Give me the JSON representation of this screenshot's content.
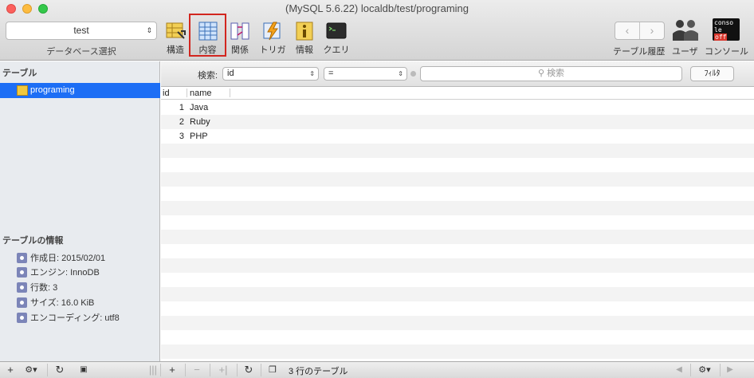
{
  "window": {
    "title": "(MySQL 5.6.22) localdb/test/programing"
  },
  "toolbar": {
    "database_selected": "test",
    "database_caption": "データベース選択",
    "buttons": [
      {
        "label": "構造",
        "icon": "structure-icon"
      },
      {
        "label": "内容",
        "icon": "content-icon",
        "active": true
      },
      {
        "label": "関係",
        "icon": "relations-icon"
      },
      {
        "label": "トリガ",
        "icon": "triggers-icon"
      },
      {
        "label": "情報",
        "icon": "info-icon"
      },
      {
        "label": "クエリ",
        "icon": "query-icon"
      }
    ],
    "history_label": "テーブル履歴",
    "user_label": "ユーザ",
    "console_label": "コンソール",
    "console_icon_text_1": "conso",
    "console_icon_text_2": "le",
    "console_icon_text_3": "off"
  },
  "sidebar": {
    "tables_heading": "テーブル",
    "tables": [
      {
        "name": "programing",
        "selected": true
      }
    ],
    "info_heading": "テーブルの情報",
    "info": [
      {
        "text": "作成日: 2015/02/01"
      },
      {
        "text": "エンジン: InnoDB"
      },
      {
        "text": "行数: 3"
      },
      {
        "text": "サイズ: 16.0 KiB"
      },
      {
        "text": "エンコーディング: utf8"
      }
    ]
  },
  "filter": {
    "label": "検索:",
    "field": "id",
    "operator": "=",
    "search_placeholder": "検索",
    "filter_button": "ﾌｨﾙﾀ"
  },
  "table": {
    "columns": [
      "id",
      "name"
    ],
    "rows": [
      {
        "id": "1",
        "name": "Java"
      },
      {
        "id": "2",
        "name": "Ruby"
      },
      {
        "id": "3",
        "name": "PHP"
      }
    ]
  },
  "statusbar": {
    "status_text": "3 行のテーブル"
  },
  "colors": {
    "selection": "#1d6ef5",
    "active_outline": "#d2261f"
  }
}
